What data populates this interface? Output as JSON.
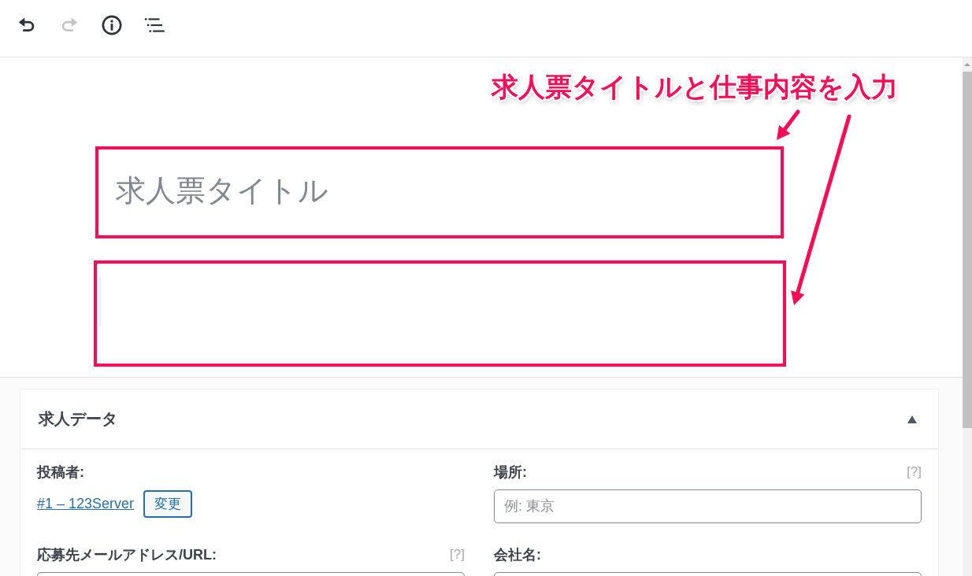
{
  "toolbar": {
    "buttons": [
      {
        "kind": "undo",
        "disabled": false
      },
      {
        "kind": "redo",
        "disabled": true
      },
      {
        "kind": "info",
        "disabled": false
      },
      {
        "kind": "outline",
        "disabled": false
      }
    ]
  },
  "annotation": {
    "text": "求人票タイトルと仕事内容を入力"
  },
  "editor": {
    "title_placeholder": "求人票タイトル"
  },
  "metabox": {
    "title": "求人データ",
    "expanded": true,
    "fields": [
      {
        "kind": "author",
        "label": "投稿者:",
        "link": "#1 – 123Server",
        "button": "変更"
      },
      {
        "kind": "text",
        "label": "場所:",
        "help": "[?]",
        "placeholder": "例: 東京"
      },
      {
        "kind": "text",
        "label": "応募先メールアドレス/URL:",
        "help": "[?]"
      },
      {
        "kind": "text",
        "label": "会社名:"
      }
    ]
  }
}
